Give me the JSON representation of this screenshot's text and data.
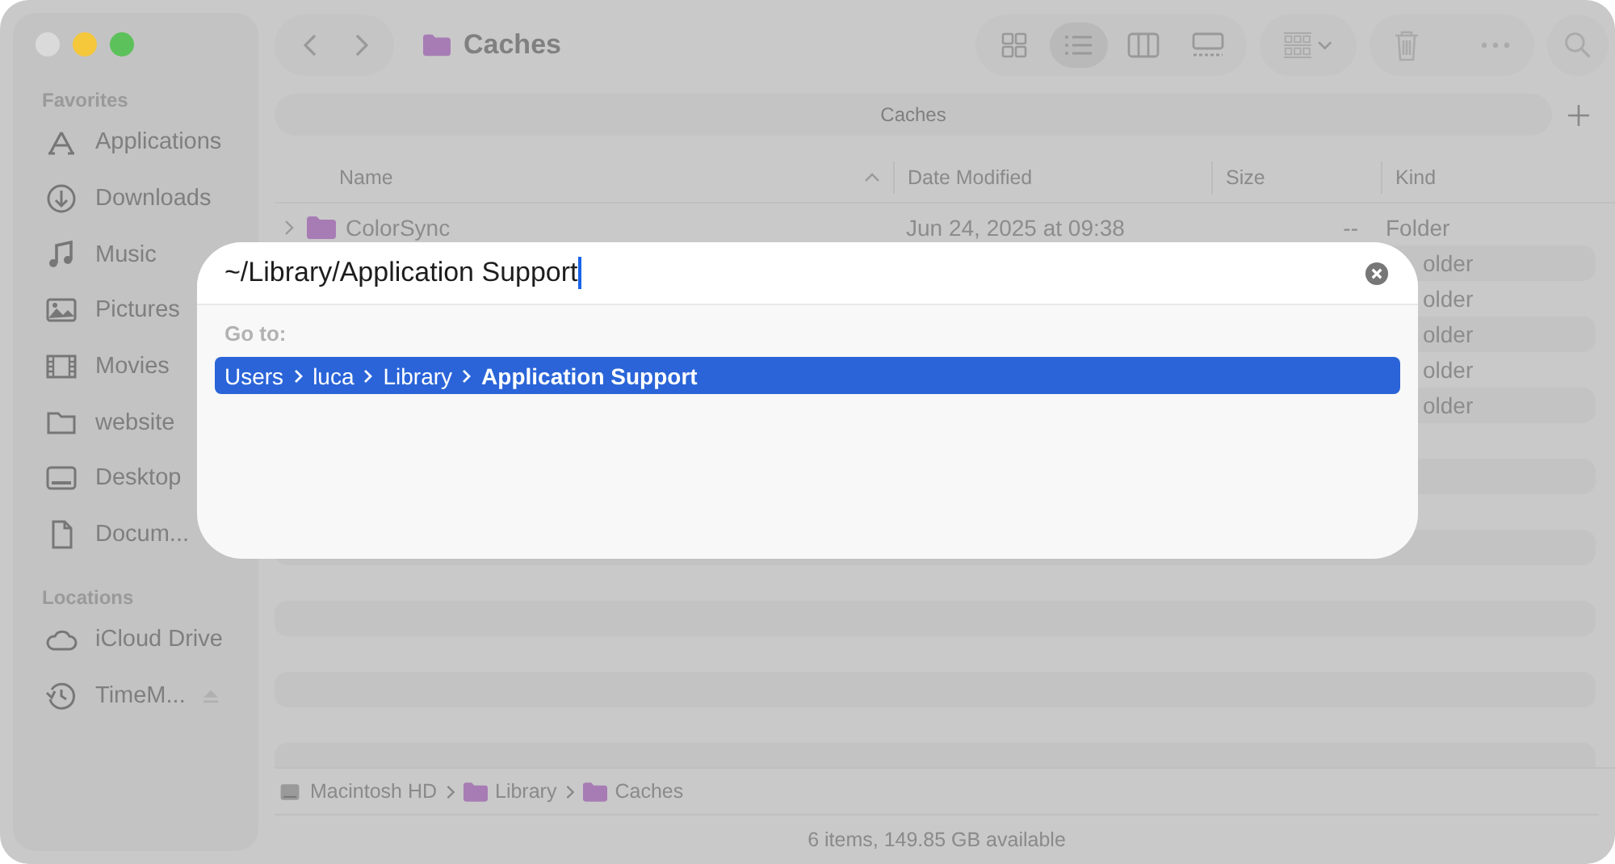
{
  "window": {
    "title": "Caches"
  },
  "toolbar": {
    "view_modes": [
      {
        "selected": false
      },
      {
        "selected": true
      },
      {
        "selected": false
      },
      {
        "selected": false
      }
    ]
  },
  "sidebar": {
    "sections": [
      {
        "heading": "Favorites",
        "items": [
          {
            "label": "Applications",
            "ejectable": false
          },
          {
            "label": "Downloads",
            "ejectable": false
          },
          {
            "label": "Music",
            "ejectable": false
          },
          {
            "label": "Pictures",
            "ejectable": false
          },
          {
            "label": "Movies",
            "ejectable": false
          },
          {
            "label": "website",
            "ejectable": false
          },
          {
            "label": "Desktop",
            "ejectable": false
          },
          {
            "label": "Docum...",
            "ejectable": false
          }
        ]
      },
      {
        "heading": "Locations",
        "items": [
          {
            "label": "iCloud Drive",
            "ejectable": false
          },
          {
            "label": "TimeM...",
            "ejectable": true
          }
        ]
      }
    ]
  },
  "tab": {
    "label": "Caches"
  },
  "table": {
    "columns": [
      {
        "label": "Name",
        "sorted": true
      },
      {
        "label": "Date Modified",
        "sorted": false
      },
      {
        "label": "Size",
        "sorted": false
      },
      {
        "label": "Kind",
        "sorted": false
      }
    ],
    "rows": [
      {
        "name": "ColorSync",
        "date": "Jun 24, 2025 at 09:38",
        "size": "--",
        "kind": "Folder"
      },
      {
        "kind": "older"
      },
      {
        "kind": "older"
      },
      {
        "kind": "older"
      },
      {
        "kind": "older"
      },
      {
        "kind": "older"
      }
    ]
  },
  "path_bar": [
    {
      "label": "Macintosh HD"
    },
    {
      "label": "Library"
    },
    {
      "label": "Caches"
    }
  ],
  "status_bar": "6 items, 149.85 GB available",
  "go_to_dialog": {
    "value": "~/Library/Application Support",
    "section_label": "Go to:",
    "suggestions": [
      {
        "segments": [
          "Users",
          "luca",
          "Library",
          "Application Support"
        ],
        "selected": true
      }
    ]
  }
}
